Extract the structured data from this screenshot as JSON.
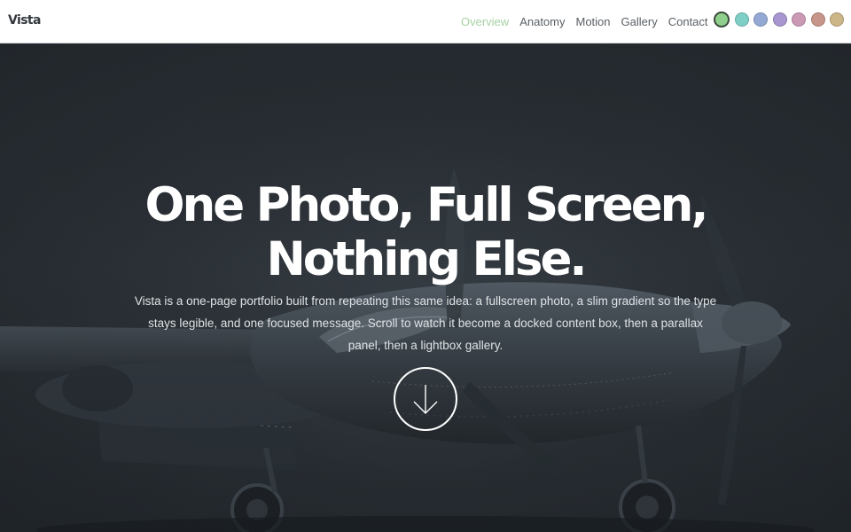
{
  "brand": {
    "name": "Vista"
  },
  "nav": {
    "items": [
      {
        "label": "Overview",
        "active": true
      },
      {
        "label": "Anatomy",
        "active": false
      },
      {
        "label": "Motion",
        "active": false
      },
      {
        "label": "Gallery",
        "active": false
      },
      {
        "label": "Contact",
        "active": false
      }
    ],
    "active_color": "#a7d1a3"
  },
  "theme_swatches": [
    {
      "name": "green",
      "color": "#8fcf8c",
      "selected": true
    },
    {
      "name": "teal",
      "color": "#7fcfc7",
      "selected": false
    },
    {
      "name": "blue",
      "color": "#93a9d4",
      "selected": false
    },
    {
      "name": "purple",
      "color": "#a796cf",
      "selected": false
    },
    {
      "name": "pink",
      "color": "#cc99b5",
      "selected": false
    },
    {
      "name": "rose",
      "color": "#c8958a",
      "selected": false
    },
    {
      "name": "gold",
      "color": "#ccb586",
      "selected": false
    }
  ],
  "hero": {
    "headline_line1": "One Photo, Full Screen,",
    "headline_line2": "Nothing Else.",
    "lede": "Vista is a one-page portfolio built from repeating this same idea: a fullscreen photo, a slim gradient so the type stays legible, and one focused message. Scroll to watch it become a docked content box, then a parallax panel, then a lightbox gallery.",
    "scroll_icon": "arrow-down-icon",
    "background_image": "vintage-propeller-airplane"
  }
}
